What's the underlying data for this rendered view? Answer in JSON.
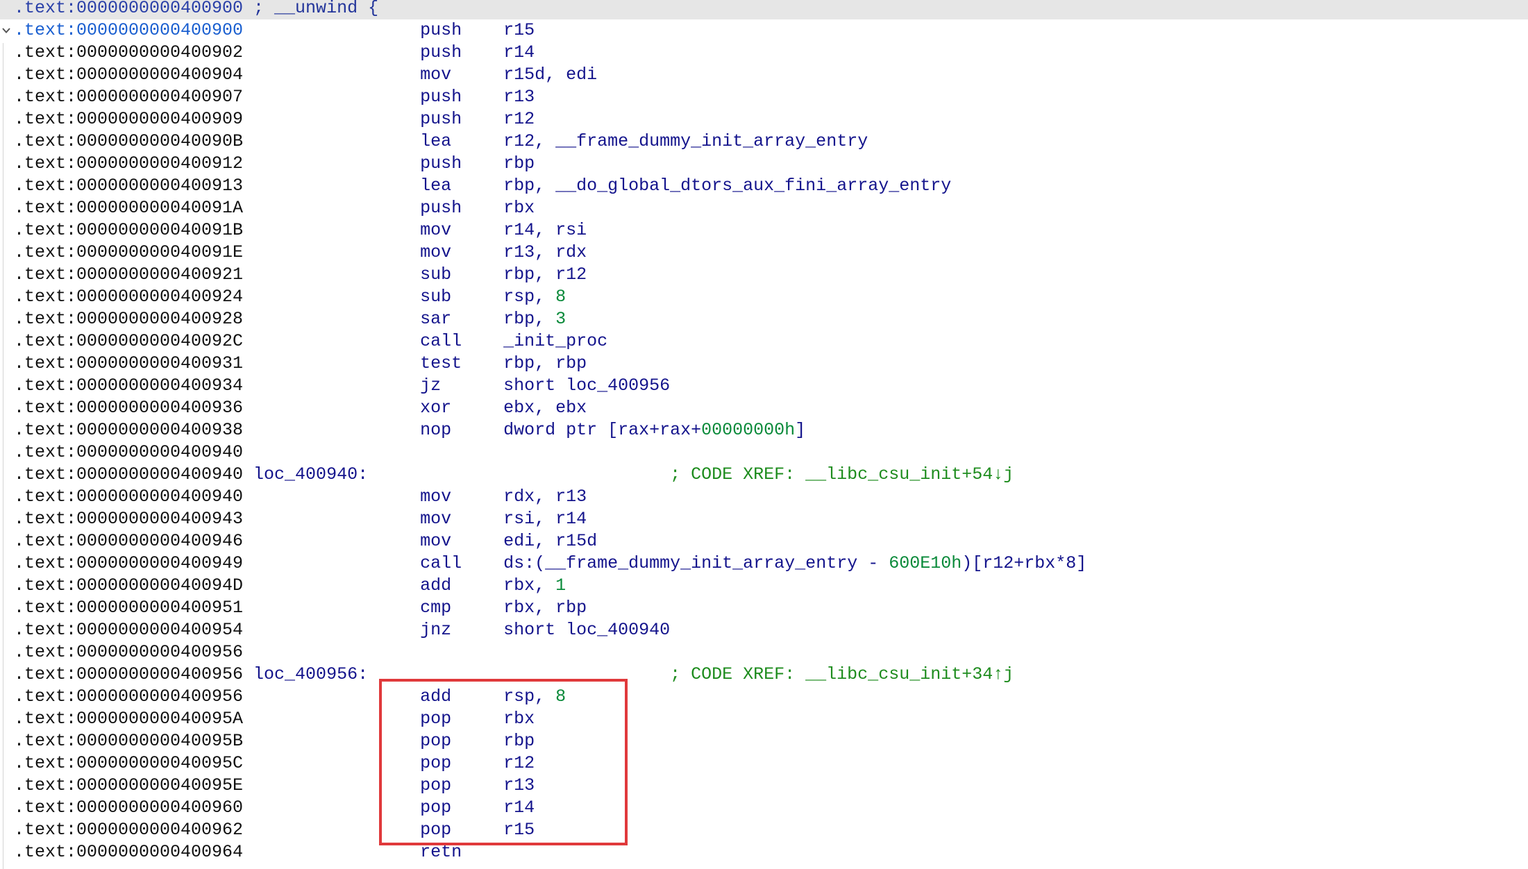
{
  "colors": {
    "address": "#111111",
    "current_address": "#2a40a8",
    "address_selected": "#1a5fd0",
    "current_line_bg": "#e6e6e6",
    "directive": "#22349a",
    "instruction": "#14148c",
    "symbol": "#14148c",
    "number": "#0a8a3a",
    "comment": "#1e8c1e",
    "annotation": "#e0393b"
  },
  "listing": {
    "lines": [
      {
        "address": ".text:0000000000400900",
        "directive": "; __unwind {",
        "bg_highlight": true
      },
      {
        "address": ".text:0000000000400900",
        "mnemonic": "push",
        "operands": [
          {
            "text": "r15"
          }
        ],
        "address_selected": true,
        "collapse_icon": "chevron-down-icon"
      },
      {
        "address": ".text:0000000000400902",
        "mnemonic": "push",
        "operands": [
          {
            "text": "r14"
          }
        ]
      },
      {
        "address": ".text:0000000000400904",
        "mnemonic": "mov",
        "operands": [
          {
            "text": "r15d, edi"
          }
        ]
      },
      {
        "address": ".text:0000000000400907",
        "mnemonic": "push",
        "operands": [
          {
            "text": "r13"
          }
        ]
      },
      {
        "address": ".text:0000000000400909",
        "mnemonic": "push",
        "operands": [
          {
            "text": "r12"
          }
        ]
      },
      {
        "address": ".text:000000000040090B",
        "mnemonic": "lea",
        "operands": [
          {
            "text": "r12, "
          },
          {
            "name": "__frame_dummy_init_array_entry"
          }
        ]
      },
      {
        "address": ".text:0000000000400912",
        "mnemonic": "push",
        "operands": [
          {
            "text": "rbp"
          }
        ]
      },
      {
        "address": ".text:0000000000400913",
        "mnemonic": "lea",
        "operands": [
          {
            "text": "rbp, "
          },
          {
            "name": "__do_global_dtors_aux_fini_array_entry"
          }
        ]
      },
      {
        "address": ".text:000000000040091A",
        "mnemonic": "push",
        "operands": [
          {
            "text": "rbx"
          }
        ]
      },
      {
        "address": ".text:000000000040091B",
        "mnemonic": "mov",
        "operands": [
          {
            "text": "r14, rsi"
          }
        ]
      },
      {
        "address": ".text:000000000040091E",
        "mnemonic": "mov",
        "operands": [
          {
            "text": "r13, rdx"
          }
        ]
      },
      {
        "address": ".text:0000000000400921",
        "mnemonic": "sub",
        "operands": [
          {
            "text": "rbp, r12"
          }
        ]
      },
      {
        "address": ".text:0000000000400924",
        "mnemonic": "sub",
        "operands": [
          {
            "text": "rsp, "
          },
          {
            "num": "8"
          }
        ]
      },
      {
        "address": ".text:0000000000400928",
        "mnemonic": "sar",
        "operands": [
          {
            "text": "rbp, "
          },
          {
            "num": "3"
          }
        ]
      },
      {
        "address": ".text:000000000040092C",
        "mnemonic": "call",
        "operands": [
          {
            "name": "_init_proc"
          }
        ]
      },
      {
        "address": ".text:0000000000400931",
        "mnemonic": "test",
        "operands": [
          {
            "text": "rbp, rbp"
          }
        ]
      },
      {
        "address": ".text:0000000000400934",
        "mnemonic": "jz",
        "operands": [
          {
            "text": "short "
          },
          {
            "name": "loc_400956"
          }
        ]
      },
      {
        "address": ".text:0000000000400936",
        "mnemonic": "xor",
        "operands": [
          {
            "text": "ebx, ebx"
          }
        ]
      },
      {
        "address": ".text:0000000000400938",
        "mnemonic": "nop",
        "operands": [
          {
            "text": "dword ptr [rax+rax+"
          },
          {
            "num": "00000000h"
          },
          {
            "text": "]"
          }
        ]
      },
      {
        "address": ".text:0000000000400940"
      },
      {
        "address": ".text:0000000000400940",
        "label": "loc_400940:",
        "comment": "; CODE XREF: __libc_csu_init+54↓j"
      },
      {
        "address": ".text:0000000000400940",
        "mnemonic": "mov",
        "operands": [
          {
            "text": "rdx, r13"
          }
        ]
      },
      {
        "address": ".text:0000000000400943",
        "mnemonic": "mov",
        "operands": [
          {
            "text": "rsi, r14"
          }
        ]
      },
      {
        "address": ".text:0000000000400946",
        "mnemonic": "mov",
        "operands": [
          {
            "text": "edi, r15d"
          }
        ]
      },
      {
        "address": ".text:0000000000400949",
        "mnemonic": "call",
        "operands": [
          {
            "text": "ds:("
          },
          {
            "name": "__frame_dummy_init_array_entry"
          },
          {
            "text": " - "
          },
          {
            "num": "600E10h"
          },
          {
            "text": ")[r12+rbx*8]"
          }
        ]
      },
      {
        "address": ".text:000000000040094D",
        "mnemonic": "add",
        "operands": [
          {
            "text": "rbx, "
          },
          {
            "num": "1"
          }
        ]
      },
      {
        "address": ".text:0000000000400951",
        "mnemonic": "cmp",
        "operands": [
          {
            "text": "rbx, rbp"
          }
        ]
      },
      {
        "address": ".text:0000000000400954",
        "mnemonic": "jnz",
        "operands": [
          {
            "text": "short "
          },
          {
            "name": "loc_400940"
          }
        ]
      },
      {
        "address": ".text:0000000000400956"
      },
      {
        "address": ".text:0000000000400956",
        "label": "loc_400956:",
        "comment": "; CODE XREF: __libc_csu_init+34↑j"
      },
      {
        "address": ".text:0000000000400956",
        "mnemonic": "add",
        "operands": [
          {
            "text": "rsp, "
          },
          {
            "num": "8"
          }
        ]
      },
      {
        "address": ".text:000000000040095A",
        "mnemonic": "pop",
        "operands": [
          {
            "text": "rbx"
          }
        ]
      },
      {
        "address": ".text:000000000040095B",
        "mnemonic": "pop",
        "operands": [
          {
            "text": "rbp"
          }
        ]
      },
      {
        "address": ".text:000000000040095C",
        "mnemonic": "pop",
        "operands": [
          {
            "text": "r12"
          }
        ]
      },
      {
        "address": ".text:000000000040095E",
        "mnemonic": "pop",
        "operands": [
          {
            "text": "r13"
          }
        ]
      },
      {
        "address": ".text:0000000000400960",
        "mnemonic": "pop",
        "operands": [
          {
            "text": "r14"
          }
        ]
      },
      {
        "address": ".text:0000000000400962",
        "mnemonic": "pop",
        "operands": [
          {
            "text": "r15"
          }
        ]
      },
      {
        "address": ".text:0000000000400964",
        "mnemonic": "retn"
      }
    ]
  }
}
